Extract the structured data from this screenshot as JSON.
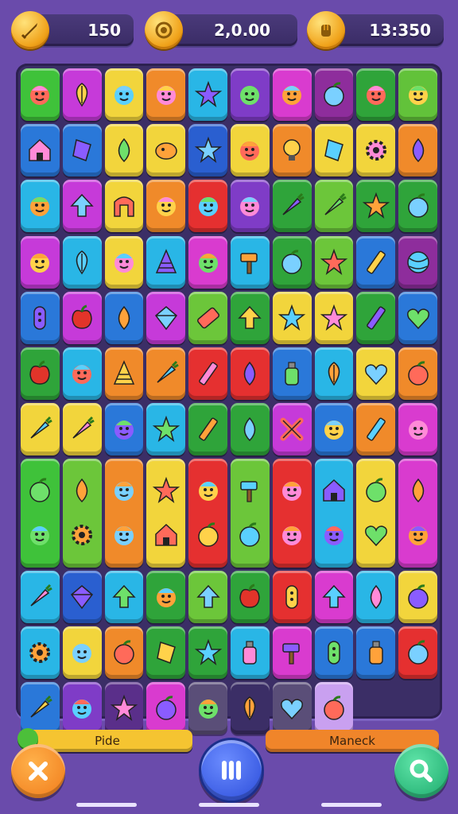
{
  "hud": {
    "left_value": "150",
    "center_value": "2,0.00",
    "right_value": "13:350",
    "icons": [
      "sword-coin-icon",
      "coin-icon",
      "fist-coin-icon"
    ]
  },
  "board": {
    "columns": 10,
    "rows": [
      [
        {
          "c": "#3fc23a",
          "i": "face"
        },
        {
          "c": "#c63ad9",
          "i": "leaf"
        },
        {
          "c": "#f2d53c",
          "i": "face"
        },
        {
          "c": "#f08a2a",
          "i": "face"
        },
        {
          "c": "#29b6e6",
          "i": "star"
        },
        {
          "c": "#7f3cc7",
          "i": "face"
        },
        {
          "c": "#d93bcf",
          "i": "face"
        },
        {
          "c": "#8e2d9c",
          "i": "fruit"
        },
        {
          "c": "#2fa43a",
          "i": "face"
        },
        {
          "c": "#62c23a",
          "i": "face"
        }
      ],
      [
        {
          "c": "#2a78d9",
          "i": "house"
        },
        {
          "c": "#2a78d9",
          "i": "shard"
        },
        {
          "c": "#f2d53c",
          "i": "drop"
        },
        {
          "c": "#f2d53c",
          "i": "blob"
        },
        {
          "c": "#2a5fd0",
          "i": "star"
        },
        {
          "c": "#f2d53c",
          "i": "face"
        },
        {
          "c": "#f08a2a",
          "i": "bulb"
        },
        {
          "c": "#f2d53c",
          "i": "shard"
        },
        {
          "c": "#f2d53c",
          "i": "gear"
        },
        {
          "c": "#f08a2a",
          "i": "drop"
        }
      ],
      [
        {
          "c": "#29b6e6",
          "i": "face"
        },
        {
          "c": "#c63ad9",
          "i": "arrow"
        },
        {
          "c": "#f2d53c",
          "i": "arch"
        },
        {
          "c": "#f08a2a",
          "i": "face"
        },
        {
          "c": "#e53030",
          "i": "face"
        },
        {
          "c": "#7f3cc7",
          "i": "face"
        },
        {
          "c": "#2fa43a",
          "i": "carrot"
        },
        {
          "c": "#6cc63a",
          "i": "carrot"
        },
        {
          "c": "#2fa43a",
          "i": "star"
        },
        {
          "c": "#2fa43a",
          "i": "fruit"
        }
      ],
      [
        {
          "c": "#c63ad9",
          "i": "face"
        },
        {
          "c": "#29b6e6",
          "i": "leaf"
        },
        {
          "c": "#f2d53c",
          "i": "face"
        },
        {
          "c": "#29b6e6",
          "i": "cone"
        },
        {
          "c": "#d93bcf",
          "i": "face"
        },
        {
          "c": "#29b6e6",
          "i": "hammer"
        },
        {
          "c": "#2fa43a",
          "i": "fruit"
        },
        {
          "c": "#6cc63a",
          "i": "star"
        },
        {
          "c": "#2a78d9",
          "i": "stick"
        },
        {
          "c": "#8e2d9c",
          "i": "ball"
        }
      ],
      [
        {
          "c": "#2a78d9",
          "i": "pill"
        },
        {
          "c": "#c63ad9",
          "i": "apple"
        },
        {
          "c": "#2a78d9",
          "i": "drop"
        },
        {
          "c": "#c63ad9",
          "i": "gem"
        },
        {
          "c": "#6cc63a",
          "i": "bar"
        },
        {
          "c": "#2fa43a",
          "i": "arrow"
        },
        {
          "c": "#f2d53c",
          "i": "star"
        },
        {
          "c": "#f2d53c",
          "i": "star"
        },
        {
          "c": "#2fa43a",
          "i": "stick"
        },
        {
          "c": "#2a78d9",
          "i": "heart"
        }
      ],
      [
        {
          "c": "#2fa43a",
          "i": "apple"
        },
        {
          "c": "#29b6e6",
          "i": "face"
        },
        {
          "c": "#f08a2a",
          "i": "cone"
        },
        {
          "c": "#f08a2a",
          "i": "carrot"
        },
        {
          "c": "#e53030",
          "i": "stick"
        },
        {
          "c": "#e53030",
          "i": "drop"
        },
        {
          "c": "#2a78d9",
          "i": "bottle"
        },
        {
          "c": "#29b6e6",
          "i": "leaf"
        },
        {
          "c": "#f2d53c",
          "i": "heart"
        },
        {
          "c": "#f08a2a",
          "i": "fruit"
        }
      ],
      [
        {
          "c": "#f2d53c",
          "i": "carrot"
        },
        {
          "c": "#f2d53c",
          "i": "carrot"
        },
        {
          "c": "#2a78d9",
          "i": "face"
        },
        {
          "c": "#29b6e6",
          "i": "star"
        },
        {
          "c": "#2fa43a",
          "i": "stick"
        },
        {
          "c": "#2fa43a",
          "i": "drop"
        },
        {
          "c": "#c63ad9",
          "i": "cross"
        },
        {
          "c": "#2a78d9",
          "i": "face"
        },
        {
          "c": "#f08a2a",
          "i": "stick"
        },
        {
          "c": "#d93bcf",
          "i": "face"
        }
      ],
      [
        {
          "c": "#3fc23a",
          "i": "fruit"
        },
        {
          "c": "#6cc63a",
          "i": "drop"
        },
        {
          "c": "#f08a2a",
          "i": "face"
        },
        {
          "c": "#f2d53c",
          "i": "star"
        },
        {
          "c": "#e53030",
          "i": "face"
        },
        {
          "c": "#6cc63a",
          "i": "hammer"
        },
        {
          "c": "#e53030",
          "i": "face"
        },
        {
          "c": "#29b6e6",
          "i": "house"
        },
        {
          "c": "#f2d53c",
          "i": "fruit"
        },
        {
          "c": "#d93bcf",
          "i": "drop"
        }
      ],
      [
        {
          "c": "#3fc23a",
          "i": "face"
        },
        {
          "c": "#6cc63a",
          "i": "gear"
        },
        {
          "c": "#f08a2a",
          "i": "face"
        },
        {
          "c": "#f2d53c",
          "i": "house"
        },
        {
          "c": "#e53030",
          "i": "fruit"
        },
        {
          "c": "#6cc63a",
          "i": "fruit"
        },
        {
          "c": "#e53030",
          "i": "face"
        },
        {
          "c": "#29b6e6",
          "i": "face"
        },
        {
          "c": "#f2d53c",
          "i": "heart"
        },
        {
          "c": "#d93bcf",
          "i": "face"
        }
      ],
      [
        {
          "c": "#29b6e6",
          "i": "carrot"
        },
        {
          "c": "#2a5fd0",
          "i": "gem"
        },
        {
          "c": "#29b6e6",
          "i": "arrow"
        },
        {
          "c": "#2fa43a",
          "i": "face"
        },
        {
          "c": "#6cc63a",
          "i": "arrow"
        },
        {
          "c": "#2fa43a",
          "i": "apple"
        },
        {
          "c": "#e53030",
          "i": "pill"
        },
        {
          "c": "#d93bcf",
          "i": "arrow"
        },
        {
          "c": "#29b6e6",
          "i": "drop"
        },
        {
          "c": "#f2d53c",
          "i": "fruit"
        }
      ],
      [
        {
          "c": "#29b6e6",
          "i": "gear"
        },
        {
          "c": "#f2d53c",
          "i": "face"
        },
        {
          "c": "#f08a2a",
          "i": "fruit"
        },
        {
          "c": "#2fa43a",
          "i": "shard"
        },
        {
          "c": "#2fa43a",
          "i": "star"
        },
        {
          "c": "#29b6e6",
          "i": "bottle"
        },
        {
          "c": "#d93bcf",
          "i": "hammer"
        },
        {
          "c": "#2a78d9",
          "i": "pill"
        },
        {
          "c": "#2a78d9",
          "i": "bottle"
        },
        {
          "c": "#e53030",
          "i": "fruit"
        }
      ],
      [
        {
          "c": "#2a78d9",
          "i": "carrot"
        },
        {
          "c": "#7f3cc7",
          "i": "face"
        },
        {
          "c": "#5a2f8a",
          "i": "star"
        },
        {
          "c": "#d93bcf",
          "i": "fruit"
        },
        {
          "c": "#5a4e78",
          "i": "face"
        },
        {
          "c": "#3b2e66",
          "i": "leaf"
        },
        {
          "c": "#5a4e78",
          "i": "heart"
        },
        {
          "c": "#c9a0f0",
          "i": "fruit"
        }
      ]
    ],
    "tall_tiles": "rows 7-8 are merged into tall tiles"
  },
  "bottom": {
    "left_bar_label": "Pide",
    "right_bar_label": "Maneck",
    "left_bar_color": "#f5c431",
    "right_bar_color": "#f0852a"
  }
}
